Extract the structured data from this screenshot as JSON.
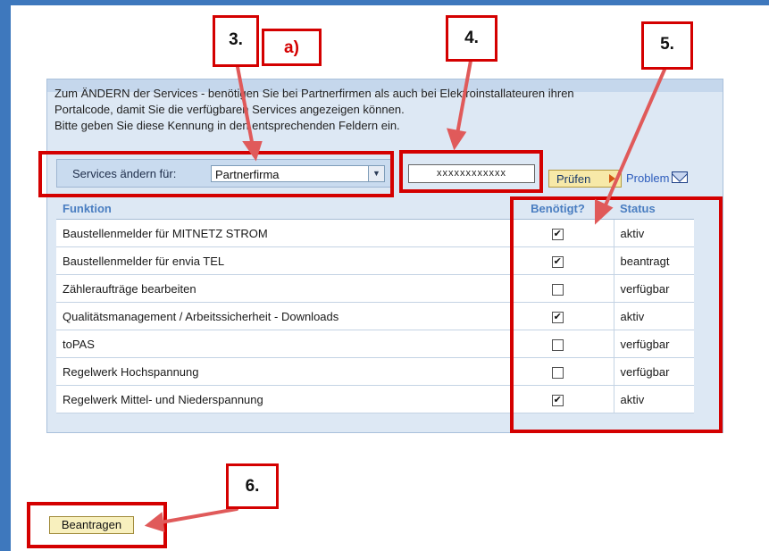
{
  "intro": {
    "line1": "Zum ÄNDERN der Services  - benötigen Sie bei Partnerfirmen als auch bei Elektroinstallateuren ihren",
    "line2": "Portalcode, damit Sie die verfügbaren Services angezeigen können.",
    "line3": "Bitte geben Sie diese Kennung in den entsprechenden Feldern ein."
  },
  "toolbar": {
    "label": "Services ändern für:",
    "select_value": "Partnerfirma",
    "code_value": "xxxxxxxxxxxx",
    "pruefen_label": "Prüfen",
    "problem_label": "Problem"
  },
  "table": {
    "headers": [
      "Funktion",
      "Benötigt?",
      "Status"
    ],
    "rows": [
      {
        "function": "Baustellenmelder für MITNETZ STROM",
        "checked": true,
        "status": "aktiv"
      },
      {
        "function": "Baustellenmelder für envia TEL",
        "checked": true,
        "status": "beantragt"
      },
      {
        "function": "Zähleraufträge bearbeiten",
        "checked": false,
        "status": "verfügbar"
      },
      {
        "function": "Qualitätsmanagement / Arbeitssicherheit - Downloads",
        "checked": true,
        "status": "aktiv"
      },
      {
        "function": "toPAS",
        "checked": false,
        "status": "verfügbar"
      },
      {
        "function": "Regelwerk Hochspannung",
        "checked": false,
        "status": "verfügbar"
      },
      {
        "function": "Regelwerk Mittel- und Niederspannung",
        "checked": true,
        "status": "aktiv"
      }
    ]
  },
  "beantragen_label": "Beantragen",
  "callouts": {
    "c3": "3.",
    "ca": "a)",
    "c4": "4.",
    "c5": "5.",
    "c6": "6."
  },
  "colors": {
    "annotation_red": "#d40000",
    "header_blue": "#4a7ec1",
    "panel_bg": "#dde8f4",
    "frame_blue": "#3e78bd"
  }
}
